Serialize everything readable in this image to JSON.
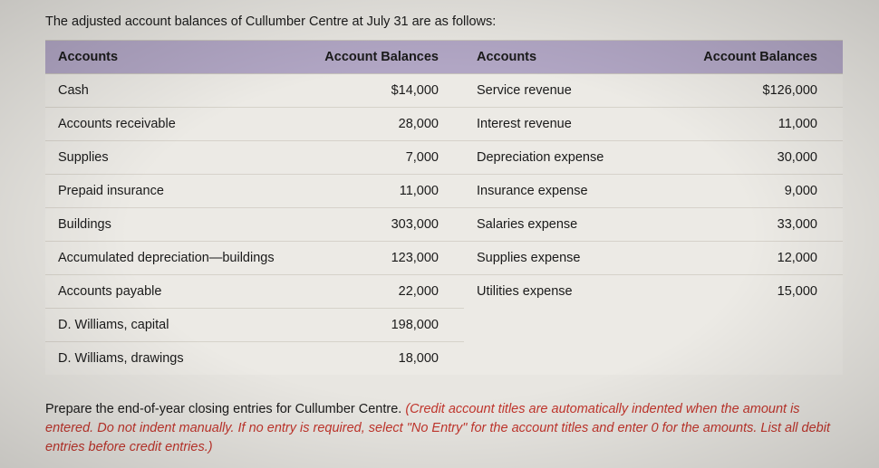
{
  "intro": "The adjusted account balances of Cullumber Centre at July 31 are as follows:",
  "headers": {
    "col1": "Accounts",
    "col2": "Account Balances",
    "col3": "Accounts",
    "col4": "Account Balances"
  },
  "left_rows": [
    {
      "name": "Cash",
      "balance": "$14,000"
    },
    {
      "name": "Accounts receivable",
      "balance": "28,000"
    },
    {
      "name": "Supplies",
      "balance": "7,000"
    },
    {
      "name": "Prepaid insurance",
      "balance": "11,000"
    },
    {
      "name": "Buildings",
      "balance": "303,000"
    },
    {
      "name": "Accumulated depreciation—buildings",
      "balance": "123,000"
    },
    {
      "name": "Accounts payable",
      "balance": "22,000"
    },
    {
      "name": "D. Williams, capital",
      "balance": "198,000"
    },
    {
      "name": "D. Williams, drawings",
      "balance": "18,000"
    }
  ],
  "right_rows": [
    {
      "name": "Service revenue",
      "balance": "$126,000"
    },
    {
      "name": "Interest revenue",
      "balance": "11,000"
    },
    {
      "name": "Depreciation expense",
      "balance": "30,000"
    },
    {
      "name": "Insurance expense",
      "balance": "9,000"
    },
    {
      "name": "Salaries expense",
      "balance": "33,000"
    },
    {
      "name": "Supplies expense",
      "balance": "12,000"
    },
    {
      "name": "Utilities expense",
      "balance": "15,000"
    }
  ],
  "instructions_plain": "Prepare the end-of-year closing entries for Cullumber Centre. ",
  "instructions_italic": "(Credit account titles are automatically indented when the amount is entered. Do not indent manually. If no entry is required, select \"No Entry\" for the account titles and enter 0 for the amounts. List all debit entries before credit entries.)"
}
